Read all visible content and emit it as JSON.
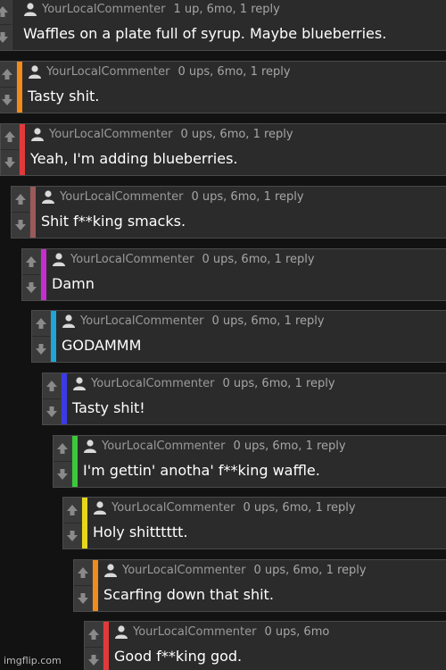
{
  "comments": [
    {
      "username": "YourLocalCommenter",
      "stats": "1 up, 6mo, 1 reply",
      "text": "Waffles on a plate full of syrup. Maybe blueberries.",
      "color": "#2b2b2b"
    },
    {
      "username": "YourLocalCommenter",
      "stats": "0 ups, 6mo, 1 reply",
      "text": "Tasty shit.",
      "color": "#f28b1c"
    },
    {
      "username": "YourLocalCommenter",
      "stats": "0 ups, 6mo, 1 reply",
      "text": "Yeah, I'm adding blueberries.",
      "color": "#e23a3a"
    },
    {
      "username": "YourLocalCommenter",
      "stats": "0 ups, 6mo, 1 reply",
      "text": "Shit f**king smacks.",
      "color": "#9a5a5a"
    },
    {
      "username": "YourLocalCommenter",
      "stats": "0 ups, 6mo, 1 reply",
      "text": "Damn",
      "color": "#c52fd0"
    },
    {
      "username": "YourLocalCommenter",
      "stats": "0 ups, 6mo, 1 reply",
      "text": "GODAMMM",
      "color": "#1ea6d9"
    },
    {
      "username": "YourLocalCommenter",
      "stats": "0 ups, 6mo, 1 reply",
      "text": "Tasty shit!",
      "color": "#3a3ae6"
    },
    {
      "username": "YourLocalCommenter",
      "stats": "0 ups, 6mo, 1 reply",
      "text": "I'm gettin' anotha' f**king waffle.",
      "color": "#3ac93a"
    },
    {
      "username": "YourLocalCommenter",
      "stats": "0 ups, 6mo, 1 reply",
      "text": "Holy shitttttt.",
      "color": "#e6d71a"
    },
    {
      "username": "YourLocalCommenter",
      "stats": "0 ups, 6mo, 1 reply",
      "text": "Scarfing down that shit.",
      "color": "#f28b1c"
    },
    {
      "username": "YourLocalCommenter",
      "stats": "0 ups, 6mo",
      "text": "Good f**king god.",
      "color": "#e23a3a"
    }
  ],
  "icons": {
    "upvote": "up-arrow-icon",
    "downvote": "down-arrow-icon",
    "avatar": "user-icon"
  },
  "watermark": "imgflip.com"
}
